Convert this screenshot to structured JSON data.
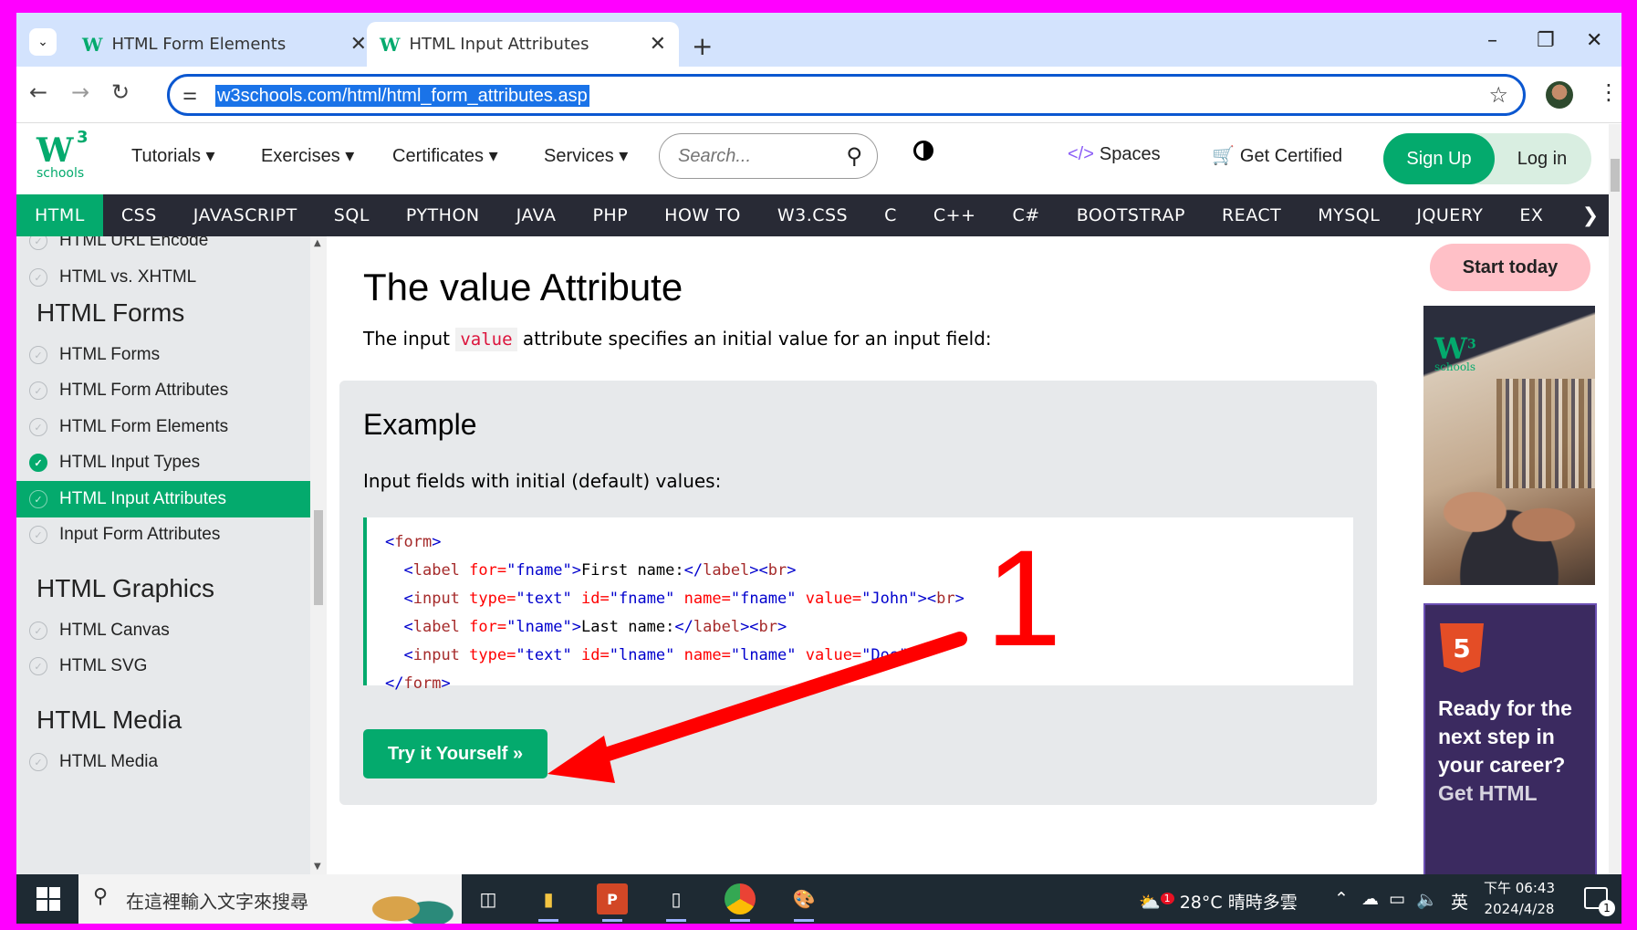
{
  "browser": {
    "tabs": [
      {
        "title": "HTML Form Elements",
        "active": false
      },
      {
        "title": "HTML Input Attributes",
        "active": true
      }
    ],
    "url": "w3schools.com/html/html_form_attributes.asp"
  },
  "header": {
    "logo_main": "W",
    "logo_sup": "3",
    "logo_sub": "schools",
    "menu": [
      "Tutorials ▾",
      "Exercises ▾",
      "Certificates ▾",
      "Services ▾"
    ],
    "search_placeholder": "Search...",
    "spaces": "Spaces",
    "get_certified": "Get Certified",
    "sign_up": "Sign Up",
    "log_in": "Log in"
  },
  "topnav": {
    "items": [
      "HTML",
      "CSS",
      "JAVASCRIPT",
      "SQL",
      "PYTHON",
      "JAVA",
      "PHP",
      "HOW TO",
      "W3.CSS",
      "C",
      "C++",
      "C#",
      "BOOTSTRAP",
      "REACT",
      "MYSQL",
      "JQUERY",
      "EX"
    ],
    "active": "HTML"
  },
  "sidebar": {
    "items": [
      {
        "label": "HTML URL Encode",
        "state": "none"
      },
      {
        "label": "HTML vs. XHTML",
        "state": "none"
      },
      {
        "label": "HTML Forms",
        "state": "head"
      },
      {
        "label": "HTML Forms",
        "state": "none"
      },
      {
        "label": "HTML Form Attributes",
        "state": "none"
      },
      {
        "label": "HTML Form Elements",
        "state": "none"
      },
      {
        "label": "HTML Input Types",
        "state": "done"
      },
      {
        "label": "HTML Input Attributes",
        "state": "active"
      },
      {
        "label": "Input Form Attributes",
        "state": "none"
      },
      {
        "label": "HTML Graphics",
        "state": "head"
      },
      {
        "label": "HTML Canvas",
        "state": "none"
      },
      {
        "label": "HTML SVG",
        "state": "none"
      },
      {
        "label": "HTML Media",
        "state": "head"
      },
      {
        "label": "HTML Media",
        "state": "none"
      }
    ]
  },
  "main": {
    "title": "The value Attribute",
    "intro_before": "The input ",
    "intro_code": "value",
    "intro_after": " attribute specifies an initial value for an input field:",
    "example_heading": "Example",
    "example_desc": "Input fields with initial (default) values:",
    "try_button": "Try it Yourself »"
  },
  "ads": {
    "start_today": "Start today",
    "ad_logo": "W",
    "ad_logo_sup": "3",
    "ad_logo_sub": "schools",
    "html5_badge": "5",
    "career_text": "Ready for the next step in your career?",
    "career_cut": "Get HTML"
  },
  "annotation": {
    "number": "1",
    "color": "#ff0000"
  },
  "taskbar": {
    "search_placeholder": "在這裡輸入文字來搜尋",
    "weather": "28°C  晴時多雲",
    "weather_badge": "1",
    "ime": "英",
    "time": "下午 06:43",
    "date": "2024/4/28",
    "notifications": "1"
  },
  "colors": {
    "accent": "#04aa6d",
    "topnav_bg": "#282a35",
    "frame": "#ff00ff"
  }
}
